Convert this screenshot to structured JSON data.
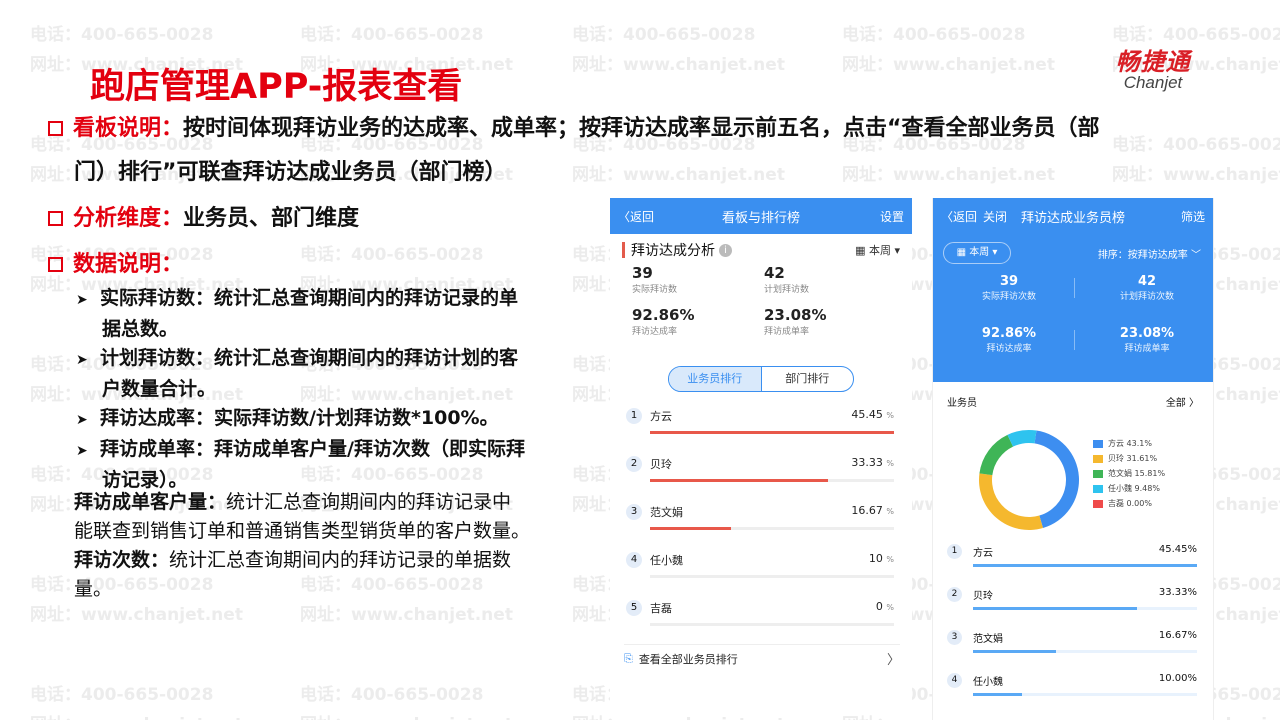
{
  "watermark": {
    "phone": "电话：400-665-0028",
    "site": "网址：www.chanjet.net"
  },
  "logo": {
    "cn": "畅捷通",
    "en": "Chanjet"
  },
  "title": "跑店管理APP-报表查看",
  "bullets": {
    "b1_key": "看板说明：",
    "b1_text": "按时间体现拜访业务的达成率、成单率；按拜访达成率显示前五名，点击“查看全部业务员（部",
    "b1_text2": "门）排行”可联查拜访达成业务员（部门榜）",
    "b2_key": "分析维度：",
    "b2_text": "业务员、部门维度",
    "b3_key": "数据说明："
  },
  "subitems": [
    {
      "l1": "实际拜访数：统计汇总查询期间内的拜访记录的单",
      "l2": "据总数。"
    },
    {
      "l1": "计划拜访数：统计汇总查询期间内的拜访计划的客",
      "l2": "户数量合计。"
    },
    {
      "l1": "拜访达成率：实际拜访数/计划拜访数*100%。",
      "l2": ""
    },
    {
      "l1": "拜访成单率：拜访成单客户量/拜访次数（即实际拜",
      "l2": "访记录）。"
    }
  ],
  "notes": {
    "n1_key": "拜访成单客户量：",
    "n1_l1": "统计汇总查询期间内的拜访记录中",
    "n1_l2": "能联查到销售订单和普通销售类型销货单的客户数量。",
    "n2_key": "拜访次数：",
    "n2_l1": "统计汇总查询期间内的拜访记录的单据数",
    "n2_l2": "量。"
  },
  "phone1": {
    "back": "〈返回",
    "title": "看板与排行榜",
    "settings": "设置",
    "section": "拜访达成分析",
    "info": "i",
    "period": "本周",
    "stats": [
      {
        "value": "39",
        "label": "实际拜访数"
      },
      {
        "value": "42",
        "label": "计划拜访数"
      },
      {
        "value": "92.86%",
        "label": "拜访达成率"
      },
      {
        "value": "23.08%",
        "label": "拜访成单率"
      }
    ],
    "tab_on": "业务员排行",
    "tab_off": "部门排行",
    "ranking": [
      {
        "rank": "1",
        "name": "方云",
        "pct": "45.45",
        "fill": 1.0,
        "color": "#e8584a"
      },
      {
        "rank": "2",
        "name": "贝玲",
        "pct": "33.33",
        "fill": 0.73,
        "color": "#e8584a"
      },
      {
        "rank": "3",
        "name": "范文娟",
        "pct": "16.67",
        "fill": 0.33,
        "color": "#e8584a"
      },
      {
        "rank": "4",
        "name": "任小魏",
        "pct": "10",
        "fill": 0.0,
        "color": "#e8584a"
      },
      {
        "rank": "5",
        "name": "吉磊",
        "pct": "0",
        "fill": 0.0,
        "color": "#e8584a"
      }
    ],
    "pct_unit": "%",
    "view_all": "查看全部业务员排行",
    "chevron": "〉"
  },
  "phone2": {
    "back": "〈返回",
    "close": "关闭",
    "title": "拜访达成业务员榜",
    "filter": "筛选",
    "period": "本周",
    "sort": "排序：按拜访达成率 ﹀",
    "stats": [
      {
        "value": "39",
        "label": "实际拜访次数"
      },
      {
        "value": "42",
        "label": "计划拜访次数"
      },
      {
        "value": "92.86%",
        "label": "拜访达成率"
      },
      {
        "value": "23.08%",
        "label": "拜访成单率"
      }
    ],
    "list_label": "业务员",
    "all": "全部 〉",
    "chart_data": {
      "type": "pie",
      "labels": [
        "方云",
        "贝玲",
        "范文娟",
        "任小魏",
        "吉磊"
      ],
      "values": [
        43.1,
        31.61,
        15.81,
        9.48,
        0.0
      ],
      "display": [
        "43.1%",
        "31.61%",
        "15.81%",
        "9.48%",
        "0.00%"
      ],
      "colors": [
        "#3d8ef0",
        "#f5b82e",
        "#3fb557",
        "#2ec3ef",
        "#ef4a4a"
      ]
    },
    "ranking": [
      {
        "rank": "1",
        "name": "方云",
        "pct": "45.45%",
        "fill": 1.0
      },
      {
        "rank": "2",
        "name": "贝玲",
        "pct": "33.33%",
        "fill": 0.73
      },
      {
        "rank": "3",
        "name": "范文娟",
        "pct": "16.67%",
        "fill": 0.37
      },
      {
        "rank": "4",
        "name": "任小魏",
        "pct": "10.00%",
        "fill": 0.22
      }
    ]
  }
}
